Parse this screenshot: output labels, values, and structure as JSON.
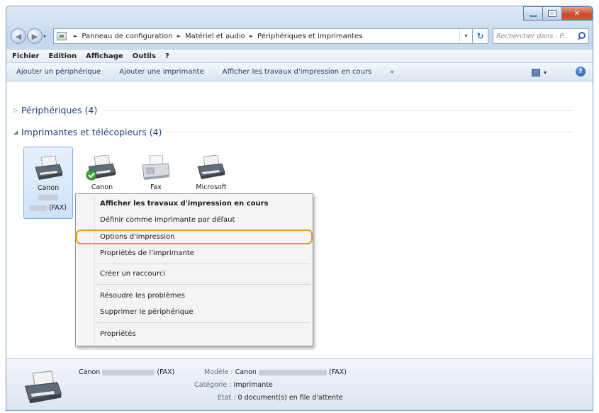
{
  "window": {
    "buttons": {
      "minimize": "minimize",
      "maximize": "maximize",
      "close": "close"
    }
  },
  "address_bar": {
    "segments": [
      "Panneau de configuration",
      "Matériel et audio",
      "Périphériques et imprimantes"
    ],
    "separator": "►",
    "search_placeholder": "Rechercher dans : P..."
  },
  "menu_bar": {
    "items": [
      "Fichier",
      "Edition",
      "Affichage",
      "Outils",
      "?"
    ]
  },
  "command_bar": {
    "items": [
      "Ajouter un périphérique",
      "Ajouter une imprimante",
      "Afficher les travaux d'impression en cours"
    ],
    "more": "»"
  },
  "groups": {
    "devices": {
      "label": "Périphériques (4)",
      "arrow": "▷"
    },
    "printers": {
      "label": "Imprimantes et télécopieurs (4)",
      "arrow": "◢"
    }
  },
  "printers": [
    {
      "name": "Canon",
      "suffix": "(FAX)",
      "selected": true,
      "default": false
    },
    {
      "name": "Canon",
      "suffix": "",
      "selected": false,
      "default": true
    },
    {
      "name": "Fax",
      "suffix": "",
      "selected": false,
      "default": false
    },
    {
      "name": "Microsoft",
      "suffix": "",
      "selected": false,
      "default": false
    }
  ],
  "context_menu": {
    "items": [
      {
        "label": "Afficher les travaux d'impression en cours",
        "bold": true
      },
      {
        "label": "Définir comme imprimante par défaut",
        "bold": false
      },
      {
        "label": "Options d'impression",
        "bold": false,
        "highlighted": true
      },
      {
        "label": "Propriétés de l'imprimante",
        "bold": false
      },
      {
        "label": "Créer un raccourci",
        "bold": false
      },
      {
        "label": "Résoudre les problèmes",
        "bold": false
      },
      {
        "label": "Supprimer le périphérique",
        "bold": false
      },
      {
        "label": "Propriétés",
        "bold": false
      }
    ],
    "highlight_color": "#eb9a22"
  },
  "details": {
    "name": "Canon",
    "name_suffix": "(FAX)",
    "model_key": "Modèle :",
    "model_value": "Canon",
    "model_suffix": "(FAX)",
    "category_key": "Catégorie :",
    "category_value": "Imprimante",
    "state_key": "Etat :",
    "state_value": "0 document(s) en file d'attente"
  }
}
